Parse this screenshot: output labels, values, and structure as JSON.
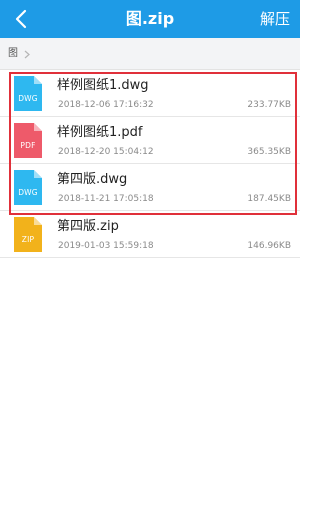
{
  "header": {
    "title": "图.zip",
    "action_label": "解压",
    "background": "#1e9be6"
  },
  "breadcrumb": {
    "items": [
      "图"
    ]
  },
  "files": [
    {
      "name": "样例图纸1.dwg",
      "date": "2018-12-06 17:16:32",
      "size": "233.77KB",
      "icon_label": "DWG",
      "icon_color": "#2eb8f0",
      "highlighted": true
    },
    {
      "name": "样例图纸1.pdf",
      "date": "2018-12-20 15:04:12",
      "size": "365.35KB",
      "icon_label": "PDF",
      "icon_color": "#ee5a6a",
      "highlighted": true
    },
    {
      "name": "第四版.dwg",
      "date": "2018-11-21 17:05:18",
      "size": "187.45KB",
      "icon_label": "DWG",
      "icon_color": "#2eb8f0",
      "highlighted": true
    },
    {
      "name": "第四版.zip",
      "date": "2019-01-03 15:59:18",
      "size": "146.96KB",
      "icon_label": "ZIP",
      "icon_color": "#f2b21b",
      "highlighted": false
    }
  ],
  "colors": {
    "highlight_border": "#e0303a"
  }
}
